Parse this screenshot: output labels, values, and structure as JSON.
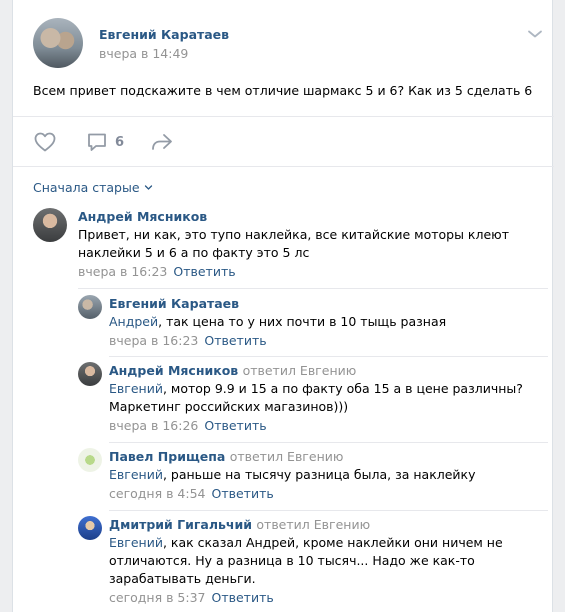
{
  "post": {
    "author": "Евгений Каратаев",
    "time": "вчера в 14:49",
    "text": "Всем привет подскажите в чем отличие шармакс 5 и 6? Как из 5 сделать 6",
    "comments_count": "6",
    "menu_icon": "chevron-down-icon",
    "like_icon": "heart-icon",
    "comment_icon": "comment-bubble-icon",
    "share_icon": "share-arrow-icon"
  },
  "comments": {
    "sort_label": "Сначала старые",
    "reply_label": "Ответить",
    "items": [
      {
        "author": "Андрей Мясников",
        "replied": "",
        "mention": "",
        "text": "Привет, ни как, это тупо наклейка, все китайские моторы клеют наклейки 5 и 6 а по факту это 5 лс",
        "time": "вчера в 16:23"
      },
      {
        "author": "Евгений Каратаев",
        "replied": "",
        "mention": "Андрей",
        "text": ", так цена то у них почти в 10 тыщь разная",
        "time": "вчера в 16:23"
      },
      {
        "author": "Андрей Мясников",
        "replied": "ответил Евгению",
        "mention": "Евгений",
        "text": ", мотор 9.9 и 15 а по факту оба 15 а в цене различны? Маркетинг российских магазинов)))",
        "time": "вчера в 16:26"
      },
      {
        "author": "Павел Прищепа",
        "replied": "ответил Евгению",
        "mention": "Евгений",
        "text": ", раньше на тысячу разница была, за наклейку",
        "time": "сегодня в 4:54"
      },
      {
        "author": "Дмитрий Гигальчий",
        "replied": "ответил Евгению",
        "mention": "Евгений",
        "text": ", как сказал Андрей, кроме наклейки они ничем не отличаются. Ну а разница в 10 тысяч... Надо же как-то зарабатывать деньги.",
        "time": "сегодня в 5:37"
      }
    ]
  },
  "colors": {
    "link": "#2a5885",
    "meta": "#939393",
    "background": "#edeef0",
    "icon": "#939ba6"
  }
}
